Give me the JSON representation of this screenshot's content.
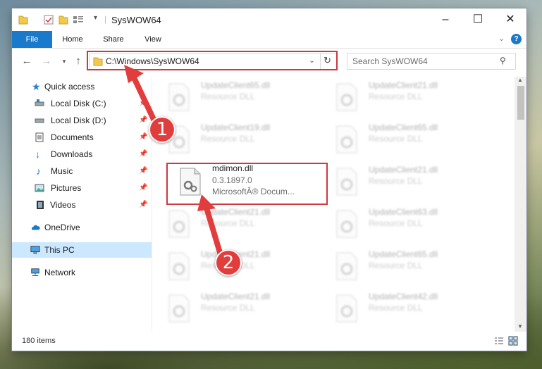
{
  "window": {
    "title": "SysWOW64",
    "controls": {
      "minimize": "–",
      "maximize": "☐",
      "close": "✕"
    }
  },
  "ribbon": {
    "tabs": [
      "File",
      "Home",
      "Share",
      "View"
    ],
    "accent": "#1979ca"
  },
  "address": {
    "path": "C:\\Windows\\SysWOW64",
    "search_placeholder": "Search SysWOW64"
  },
  "sidebar": {
    "items": [
      {
        "label": "Quick access",
        "icon": "star-icon"
      },
      {
        "label": "Local Disk (C:)",
        "icon": "drive-icon"
      },
      {
        "label": "Local Disk (D:)",
        "icon": "drive-icon"
      },
      {
        "label": "Documents",
        "icon": "documents-icon"
      },
      {
        "label": "Downloads",
        "icon": "download-icon"
      },
      {
        "label": "Music",
        "icon": "music-icon"
      },
      {
        "label": "Pictures",
        "icon": "pictures-icon"
      },
      {
        "label": "Videos",
        "icon": "videos-icon"
      },
      {
        "label": "OneDrive",
        "icon": "cloud-icon"
      },
      {
        "label": "This PC",
        "icon": "computer-icon"
      },
      {
        "label": "Network",
        "icon": "network-icon"
      }
    ]
  },
  "files": {
    "highlighted": {
      "name": "mdimon.dll",
      "version": "0.3.1897.0",
      "description": "MicrosoftÂ® Docum..."
    },
    "left_column": [
      {
        "name": "UpdateClient65.dll",
        "type": "Resource DLL"
      },
      {
        "name": "UpdateClient19.dll",
        "type": "Resource DLL"
      },
      {
        "name": "UpdateClient21.dll",
        "type": "Resource DLL"
      },
      {
        "name": "UpdateClient21.dll",
        "type": "Resource DLL"
      },
      {
        "name": "UpdateClient21.dll",
        "type": "Resource DLL"
      }
    ],
    "right_column": [
      {
        "name": "UpdateClient21.dll",
        "type": "Resource DLL"
      },
      {
        "name": "UpdateClient65.dll",
        "type": "Resource DLL"
      },
      {
        "name": "UpdateClient21.dll",
        "type": "Resource DLL"
      },
      {
        "name": "UpdateClient63.dll",
        "type": "Resource DLL"
      },
      {
        "name": "UpdateClient65.dll",
        "type": "Resource DLL"
      },
      {
        "name": "UpdateClient42.dll",
        "type": "Resource DLL"
      }
    ]
  },
  "status": {
    "item_count": "180 items"
  },
  "annotations": {
    "step1": "1",
    "step2": "2",
    "color": "#d0373f"
  }
}
